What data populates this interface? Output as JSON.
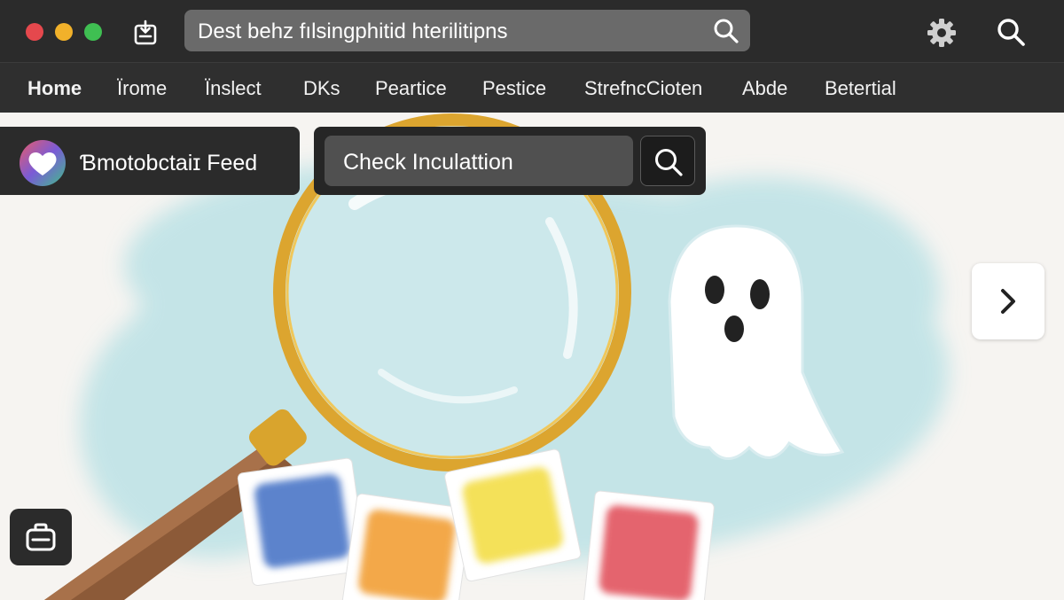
{
  "titlebar": {
    "address_text": "Dest behz fılsingphitid hterilitipns",
    "icons": [
      "window-controls",
      "inbox-download-icon",
      "search-icon",
      "gear-icon",
      "search-icon"
    ]
  },
  "nav": {
    "items": [
      {
        "label": "Home",
        "active": true
      },
      {
        "label": "Ïrome",
        "active": false
      },
      {
        "label": "Ïnslect",
        "active": false
      },
      {
        "label": "DKs",
        "active": false
      },
      {
        "label": "Peartice",
        "active": false
      },
      {
        "label": "Pestice",
        "active": false
      },
      {
        "label": "StrefncCioten",
        "active": false
      },
      {
        "label": "Abde",
        "active": false
      },
      {
        "label": "Betertial",
        "active": false
      }
    ]
  },
  "feed": {
    "title": "Ɓmotobctaiɪ Feed",
    "avatar_icon": "heart-icon"
  },
  "search": {
    "placeholder": "Check Inculattion",
    "button_icon": "search-icon"
  },
  "colors": {
    "chrome": "#2b2b2b",
    "accent_red": "#e5484d",
    "accent_yellow": "#f1b12a",
    "accent_green": "#3fbf52",
    "wash": "#bfe3e6",
    "swatch_blue": "#3f6ec4",
    "swatch_orange": "#f19a2a",
    "swatch_yellow": "#f3dc3c",
    "swatch_red": "#e04a55"
  }
}
